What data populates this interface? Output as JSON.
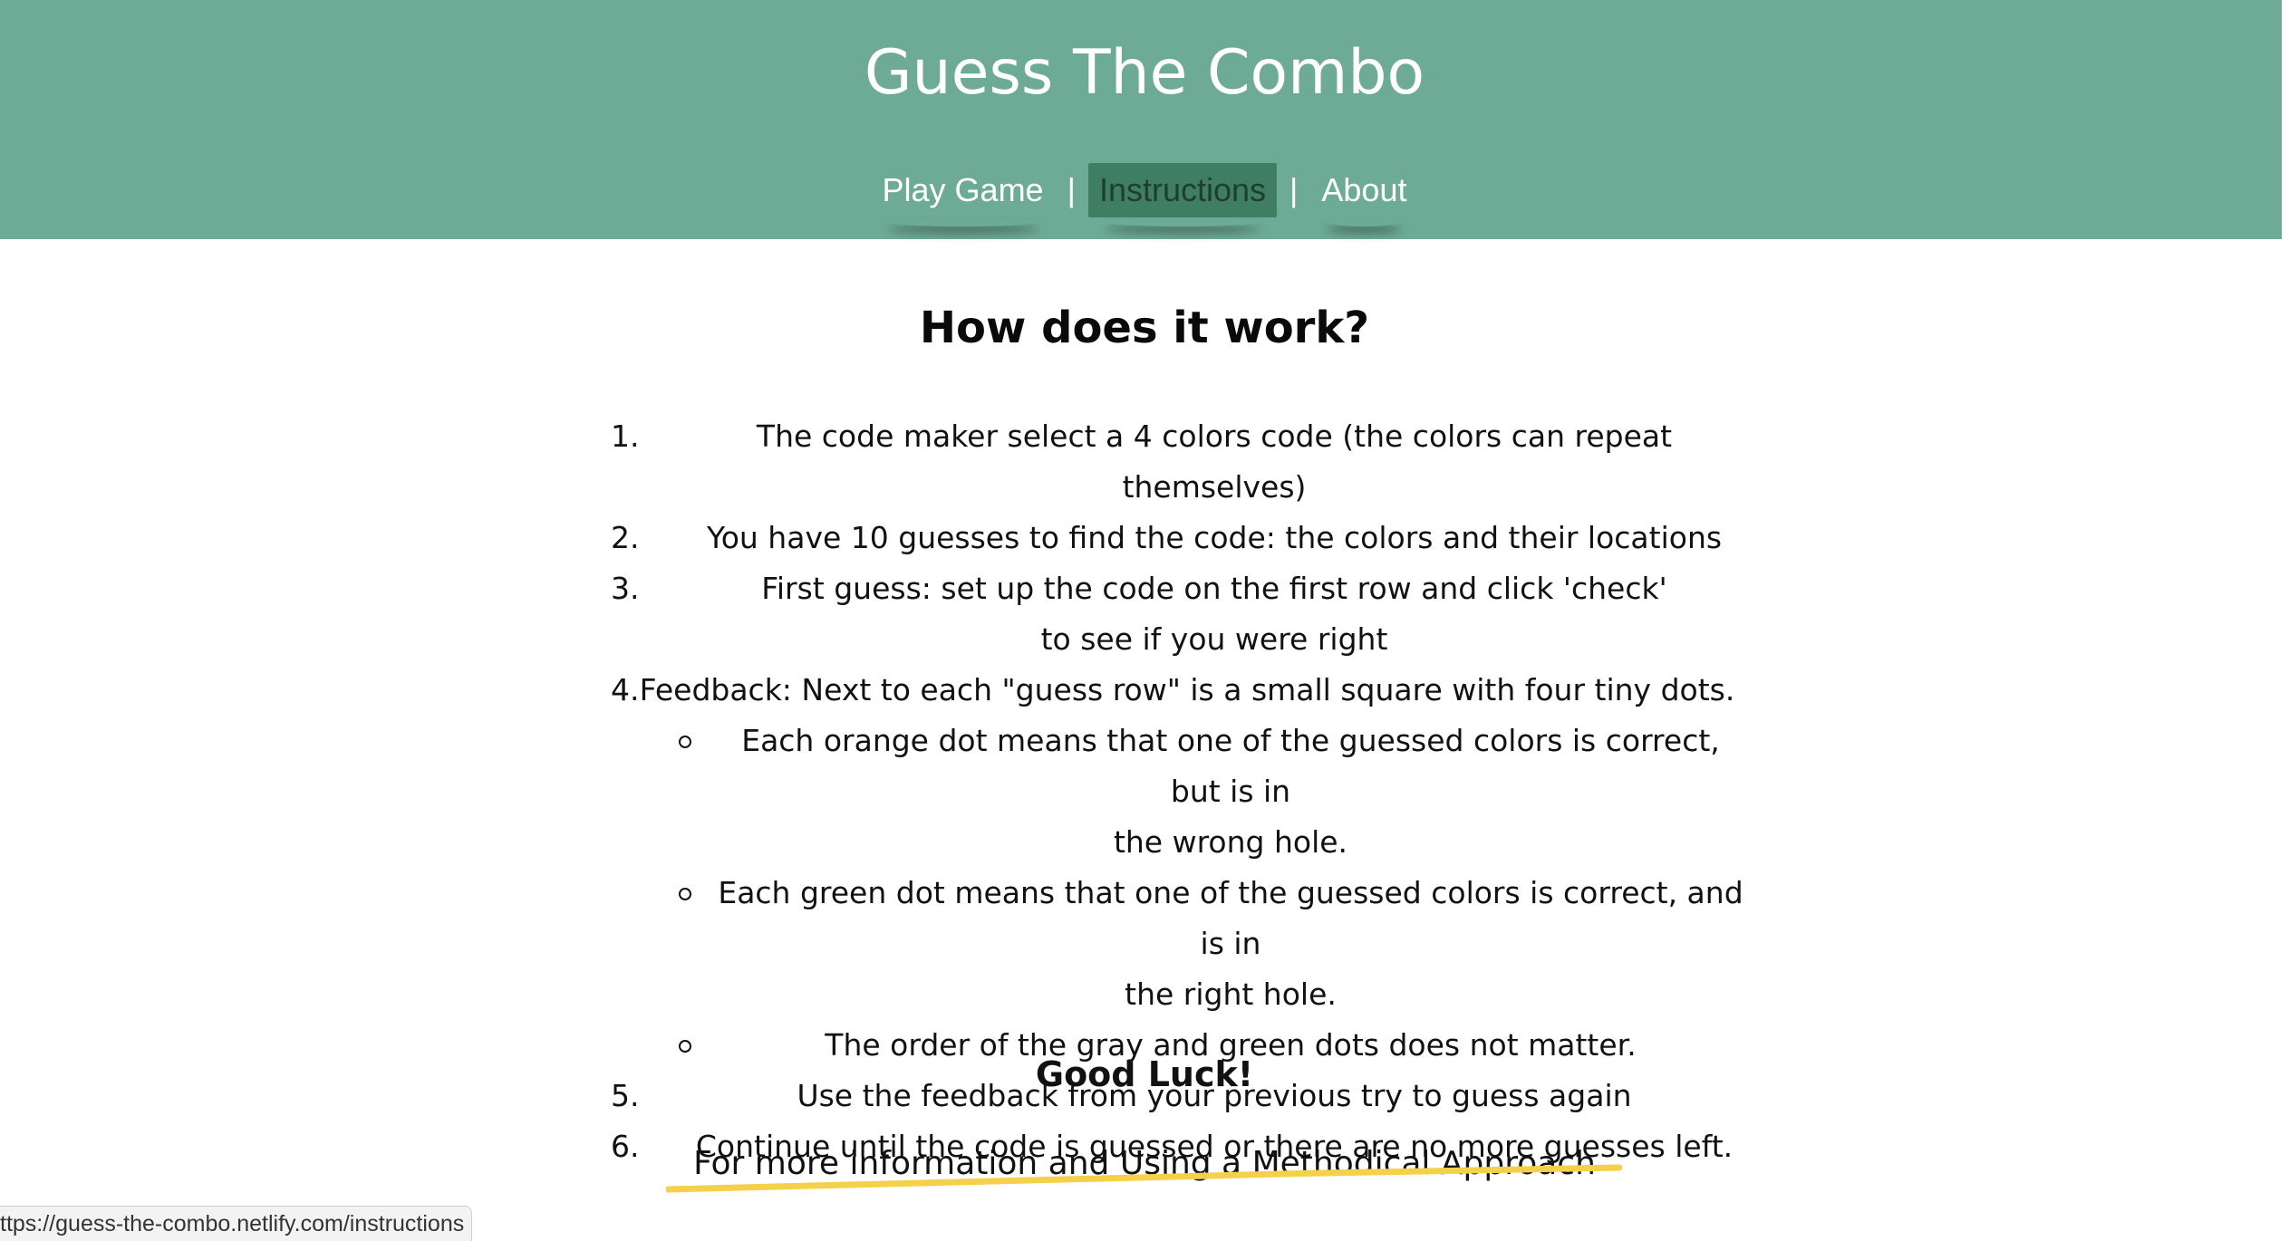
{
  "header": {
    "title": "Guess The Combo",
    "nav": [
      {
        "label": "Play Game"
      },
      {
        "label": "Instructions"
      },
      {
        "label": "About"
      }
    ],
    "separator": "|"
  },
  "main": {
    "heading": "How does it work?",
    "steps": [
      {
        "num": "1.",
        "text": "The code maker select a 4 colors code (the colors can repeat themselves)"
      },
      {
        "num": "2.",
        "text": "You have 10 guesses to find the code: the colors and their locations"
      },
      {
        "num": "3.",
        "line1": "First guess: set up the code on the first row and click 'check'",
        "line2": "to see if you were right"
      },
      {
        "num": "4.",
        "text": "Feedback: Next to each \"guess row\" is a small square with four tiny dots.",
        "sub": [
          {
            "line1": "Each orange dot means that one of the guessed colors is correct, but is in",
            "line2": "the wrong hole."
          },
          {
            "line1": "Each green dot means that one of the guessed colors is correct, and is in",
            "line2": "the right hole."
          },
          {
            "line1": "The order of the gray and green dots does not matter."
          }
        ]
      },
      {
        "num": "5.",
        "text": "Use the feedback from your previous try to guess again"
      },
      {
        "num": "6.",
        "text": "Continue until the code is guessed or there are no more guesses left."
      }
    ],
    "good_luck": "Good Luck!",
    "more_info": "For more information and Using a Methodical Approach"
  },
  "status_bar": {
    "url": "ttps://guess-the-combo.netlify.com/instructions"
  },
  "colors": {
    "header_bg": "#6eab97",
    "nav_active_bg": "#3f7e62",
    "underline": "#f5d04a"
  }
}
